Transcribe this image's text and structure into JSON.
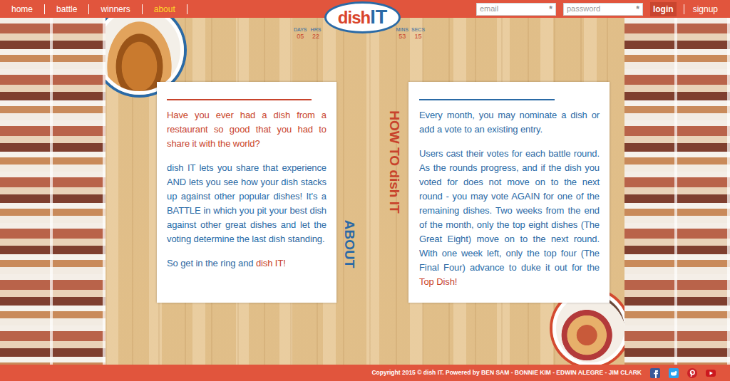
{
  "nav": [
    {
      "label": "home",
      "selected": false
    },
    {
      "label": "battle",
      "selected": false
    },
    {
      "label": "winners",
      "selected": false
    },
    {
      "label": "about",
      "selected": true
    }
  ],
  "logo": {
    "first": "dish",
    "second": "IT"
  },
  "login_form": {
    "email": {
      "placeholder": "email",
      "marker": "*"
    },
    "password": {
      "placeholder": "password",
      "marker": "*"
    },
    "login": "login",
    "signup": "signup"
  },
  "countdown": [
    {
      "label": "DAYS",
      "value": "05"
    },
    {
      "label": "HRS",
      "value": "22"
    },
    {
      "label": "MINS",
      "value": "53"
    },
    {
      "label": "SECS",
      "value": "15"
    }
  ],
  "about": {
    "heading": "ABOUT",
    "paragraphs": [
      [
        {
          "text": "Have you ever had a dish from a restaurant so good that you had to share it with the world?",
          "kind": "accent"
        }
      ],
      [
        {
          "text": "dish IT lets you share that experience AND lets you see how your dish stacks up against other popular dishes! It's a BATTLE in which you pit your best dish against other great dishes and let the voting determine the last dish standing.",
          "kind": "plain"
        }
      ],
      [
        {
          "text": "So get in the ring and ",
          "kind": "plain"
        },
        {
          "text": "dish IT!",
          "kind": "accent"
        }
      ]
    ]
  },
  "how_to": {
    "heading": "HOW TO dish IT",
    "paragraphs": [
      [
        {
          "text": "Every month, you may nominate a dish or add a vote to an existing entry.",
          "kind": "plain"
        }
      ],
      [
        {
          "text": "Users cast their votes for each battle round. As the rounds progress, and if the dish you voted for does not move on to the next round - you may vote AGAIN for one of the remaining dishes. Two weeks from the end of the month, only the top eight dishes (The Great Eight) move on to the next round. With one week left, only the top four (The Final Four) advance to duke it out for the ",
          "kind": "plain"
        },
        {
          "text": "Top Dish!",
          "kind": "accent"
        }
      ]
    ]
  },
  "footer": {
    "copyright": "Copyright 2015 © dish IT. Powered by BEN SAM - BONNIE KIM - EDWIN ALEGRE - JIM CLARK"
  }
}
